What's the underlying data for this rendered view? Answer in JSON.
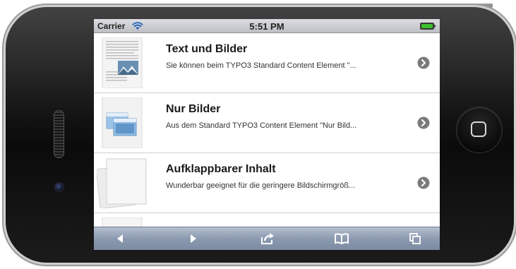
{
  "status_bar": {
    "carrier": "Carrier",
    "time": "5:51 PM",
    "wifi_icon": "wifi-icon",
    "battery_icon": "battery-full-icon",
    "battery_color": "#3fbf2f"
  },
  "list": {
    "items": [
      {
        "title": "Text und Bilder",
        "description": "Sie können beim TYPO3 Standard Content Element \"...",
        "thumb": "text-and-image-thumbnail",
        "chevron_icon": "chevron-right-icon"
      },
      {
        "title": "Nur Bilder",
        "description": "Aus dem Standard TYPO3 Content Element \"Nur Bild...",
        "thumb": "images-only-thumbnail",
        "chevron_icon": "chevron-right-icon"
      },
      {
        "title": "Aufklappbarer Inhalt",
        "description": "Wunderbar geeignet für die geringere Bildschirmgröß...",
        "thumb": "accordion-content-thumbnail",
        "chevron_icon": "chevron-right-icon"
      }
    ]
  },
  "toolbar": {
    "icons": [
      "back-icon",
      "forward-icon",
      "share-icon",
      "bookmarks-icon",
      "tabs-icon"
    ]
  },
  "colors": {
    "toolbar": "#8c9ab0",
    "chevron": "#7a7a7a"
  }
}
